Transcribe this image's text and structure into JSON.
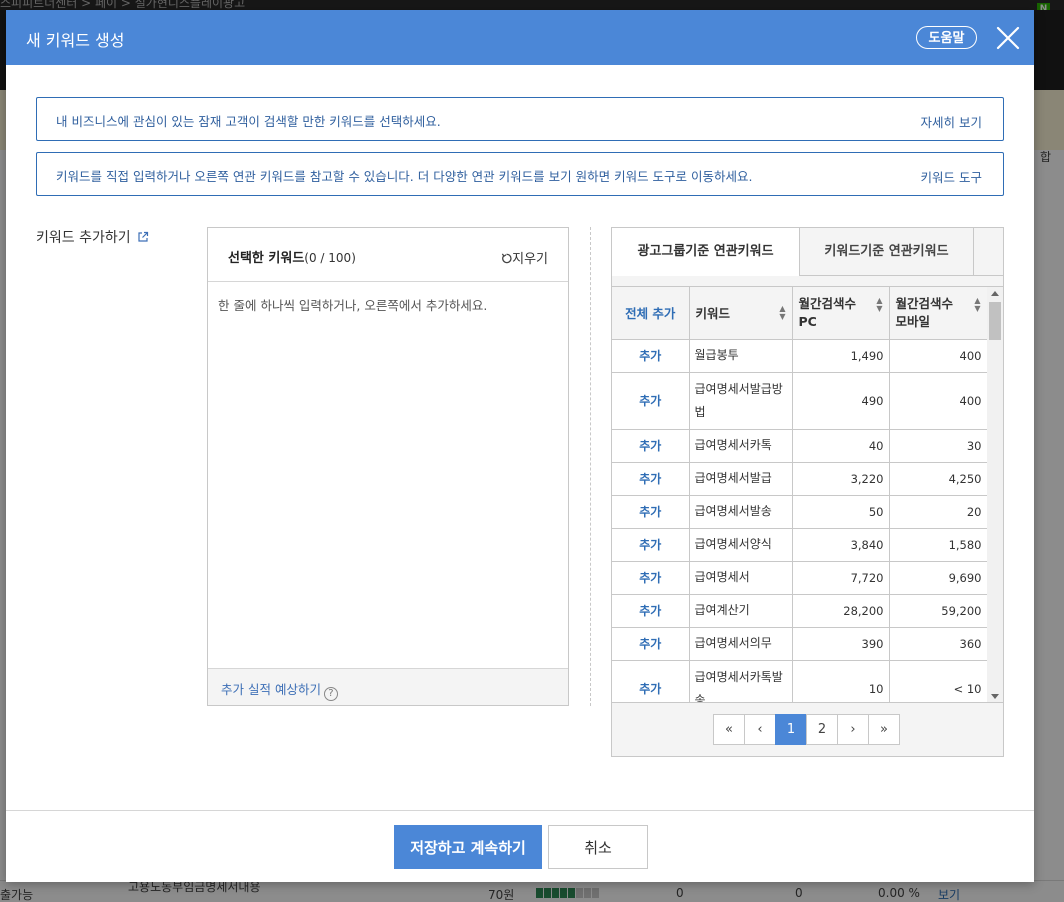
{
  "background": {
    "breadcrumb": "스피피트너센터 > 페이 > 설가현디스플레이광고",
    "badge": "N",
    "row_keyword": "고용노동부임금명세서내용",
    "row_status": "출가능",
    "row_price": "70원",
    "row_zero1": "0",
    "row_zero2": "0",
    "row_pct": "0.00 %",
    "row_view": "보기",
    "side_label": "합"
  },
  "modal": {
    "title": "새 키워드 생성",
    "help_label": "도움말",
    "info1": {
      "message": "내 비즈니스에 관심이 있는 잠재 고객이 검색할 만한 키워드를 선택하세요.",
      "link": "자세히 보기"
    },
    "info2": {
      "message": "키워드를 직접 입력하거나 오른쪽 연관 키워드를 참고할 수 있습니다. 더 다양한 연관 키워드를 보기 원하면 키워드 도구로 이동하세요.",
      "link": "키워드 도구"
    },
    "add_keywords_label": "키워드 추가하기",
    "selected": {
      "title": "선택한 키워드",
      "count": "(0 / 100)",
      "clear_label": "지우기",
      "placeholder": "한 줄에 하나씩 입력하거나, 오른쪽에서 추가하세요.",
      "estimate_label": "추가 실적 예상하기"
    },
    "related": {
      "tabs": [
        {
          "label": "광고그룹기준 연관키워드",
          "active": true
        },
        {
          "label": "키워드기준 연관키워드",
          "active": false
        }
      ],
      "columns": {
        "add_all": "전체 추가",
        "keyword": "키워드",
        "pc_line1": "월간검색수",
        "pc_line2": "PC",
        "mobile_line1": "월간검색수",
        "mobile_line2": "모바일"
      },
      "add_label": "추가",
      "rows": [
        {
          "keyword": "월급봉투",
          "pc": "1,490",
          "mobile": "400"
        },
        {
          "keyword": "급여명세서발급방법",
          "pc": "490",
          "mobile": "400"
        },
        {
          "keyword": "급여명세서카톡",
          "pc": "40",
          "mobile": "30"
        },
        {
          "keyword": "급여명세서발급",
          "pc": "3,220",
          "mobile": "4,250"
        },
        {
          "keyword": "급여명세서발송",
          "pc": "50",
          "mobile": "20"
        },
        {
          "keyword": "급여명세서양식",
          "pc": "3,840",
          "mobile": "1,580"
        },
        {
          "keyword": "급여명세서",
          "pc": "7,720",
          "mobile": "9,690"
        },
        {
          "keyword": "급여계산기",
          "pc": "28,200",
          "mobile": "59,200"
        },
        {
          "keyword": "급여명세서의무",
          "pc": "390",
          "mobile": "360"
        },
        {
          "keyword": "급여명세서카톡발송",
          "pc": "10",
          "mobile": "< 10"
        }
      ],
      "pager": {
        "first": "«",
        "prev": "‹",
        "pages": [
          "1",
          "2"
        ],
        "current": "1",
        "next": "›",
        "last": "»"
      }
    },
    "save_label": "저장하고 계속하기",
    "cancel_label": "취소"
  },
  "colors": {
    "header": "#4b87d7",
    "link": "#2f6db5",
    "border": "#c8c8c8"
  },
  "icons": [
    "close-icon",
    "external-link-icon",
    "refresh-icon",
    "help-circle-icon",
    "sort-icon"
  ]
}
